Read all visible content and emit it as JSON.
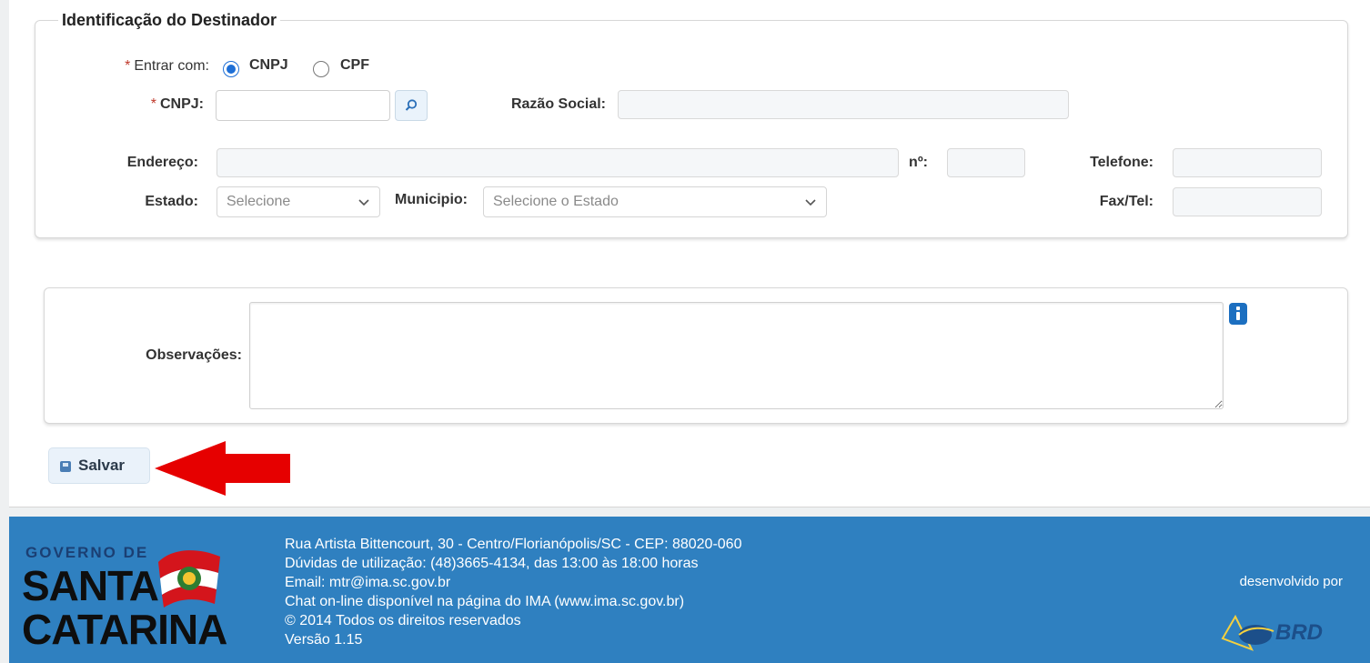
{
  "destinador": {
    "legend": "Identificação do Destinador",
    "entrar_com": {
      "label": "Entrar com:",
      "options": [
        "CNPJ",
        "CPF"
      ],
      "selected": "CNPJ"
    },
    "cnpj_label": "CNPJ:",
    "cnpj_value": "",
    "razao_social_label": "Razão Social:",
    "endereco_label": "Endereço:",
    "numero_label": "nº:",
    "telefone_label": "Telefone:",
    "estado_label": "Estado:",
    "estado_value": "Selecione",
    "municipio_label": "Municipio:",
    "municipio_value": "Selecione o Estado",
    "fax_label": "Fax/Tel:"
  },
  "observacoes": {
    "label": "Observações:",
    "value": ""
  },
  "actions": {
    "save_label": "Salvar"
  },
  "footer": {
    "logo_top": "GOVERNO DE",
    "logo_line1": "SANTA",
    "logo_line2": "CATARINA",
    "lines": [
      "Rua Artista Bittencourt, 30 - Centro/Florianópolis/SC - CEP: 88020-060",
      "Dúvidas de utilização: (48)3665-4134, das 13:00 às 18:00 horas",
      "Email: mtr@ima.sc.gov.br",
      "Chat on-line disponível na página do IMA (www.ima.sc.gov.br)",
      "© 2014 Todos os direitos reservados",
      "Versão 1.15"
    ],
    "developed_by": "desenvolvido por",
    "developer_logo": "BRD"
  },
  "colors": {
    "footer_bg": "#2f80c0",
    "arrow": "#e60000",
    "radio_selected": "#1e6fd6",
    "required_mark": "#c0392b"
  },
  "icons": {
    "search": "search-icon",
    "info": "info-icon",
    "save": "save-icon",
    "dropdown": "chevron-down-icon",
    "annotation": "red-arrow-icon"
  }
}
